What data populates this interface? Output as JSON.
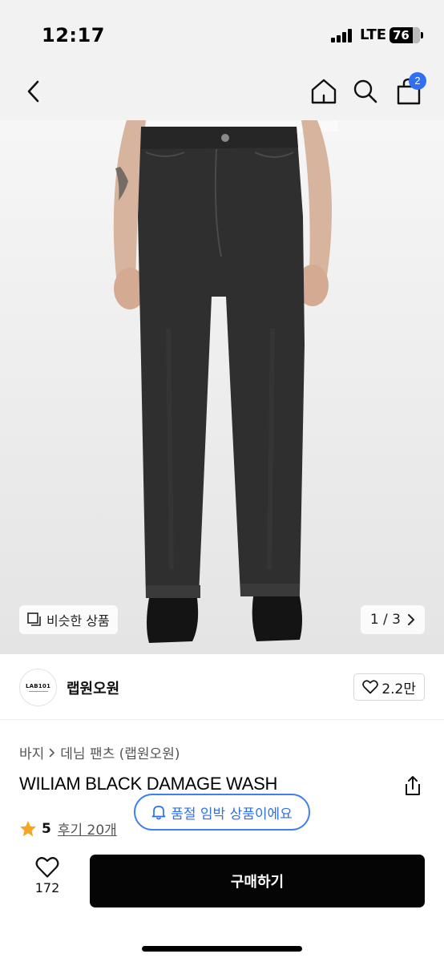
{
  "status_bar": {
    "time": "12:17",
    "network": "LTE",
    "battery": "76"
  },
  "nav": {
    "cart_count": "2",
    "icons": [
      "chevron-left-icon",
      "home-icon",
      "search-icon",
      "shopping-bag-icon"
    ]
  },
  "gallery": {
    "similar_label": "비슷한 상품",
    "page_indicator": "1 / 3"
  },
  "shop": {
    "logo_text": "LAB101",
    "name": "랩원오원",
    "like_count": "2.2만"
  },
  "product": {
    "breadcrumb": [
      "바지",
      "데님 팬츠 (랩원오원)"
    ],
    "title": "WILIAM BLACK DAMAGE WASH",
    "stock_notice": "품절 임박 상품이에요",
    "rating": "5",
    "review_link": "후기 20개"
  },
  "bottom_bar": {
    "favorite_count": "172",
    "buy_label": "구매하기"
  },
  "colors": {
    "accent_blue": "#2f6ff5",
    "star": "#f5a623",
    "buy_button": "#050505"
  }
}
